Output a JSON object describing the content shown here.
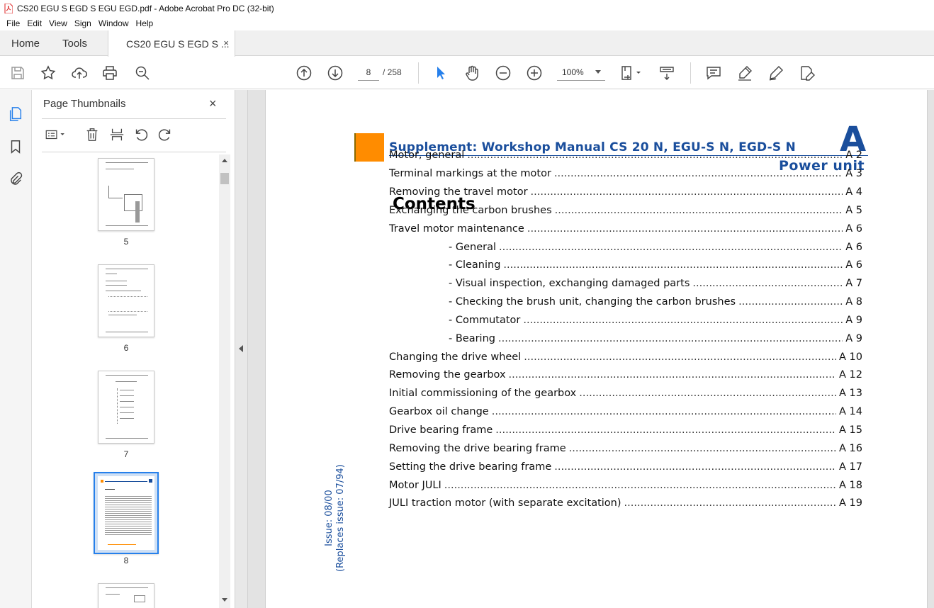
{
  "window": {
    "title": "CS20 EGU S EGD S EGU EGD.pdf - Adobe Acrobat Pro DC (32-bit)"
  },
  "menu": [
    "File",
    "Edit",
    "View",
    "Sign",
    "Window",
    "Help"
  ],
  "tabs": {
    "home": "Home",
    "tools": "Tools",
    "document": "CS20 EGU S EGD S ...",
    "close": "×"
  },
  "toolbar": {
    "page_current": "8",
    "page_total": "/  258",
    "zoom": "100%"
  },
  "panel": {
    "title": "Page Thumbnails",
    "close": "×",
    "thumbnails": [
      "5",
      "6",
      "7",
      "8"
    ]
  },
  "document": {
    "header": "Supplement: Workshop Manual CS 20 N, EGU-S N, EGD-S N",
    "section_letter": "A",
    "section_title": "Power  unit",
    "contents_title": "Contents",
    "issue_line1": "Issue:  08/00",
    "issue_line2": "(Replaces  issue:  07/94)",
    "toc": [
      {
        "title": "Motor, general",
        "page": "A 2",
        "sub": false
      },
      {
        "title": "Terminal markings at the motor",
        "page": "A 3",
        "sub": false
      },
      {
        "title": "Removing the travel motor",
        "page": "A 4",
        "sub": false
      },
      {
        "title": "Exchanging the carbon brushes",
        "page": "A 5",
        "sub": false
      },
      {
        "title": "Travel motor maintenance",
        "page": "A 6",
        "sub": false
      },
      {
        "title": "- General",
        "page": "A 6",
        "sub": true
      },
      {
        "title": "- Cleaning",
        "page": "A 6",
        "sub": true
      },
      {
        "title": "- Visual inspection, exchanging damaged parts",
        "page": "A 7",
        "sub": true
      },
      {
        "title": "- Checking the brush unit, changing the carbon brushes",
        "page": "A 8",
        "sub": true
      },
      {
        "title": "- Commutator",
        "page": "A 9",
        "sub": true
      },
      {
        "title": "- Bearing",
        "page": "A 9",
        "sub": true
      },
      {
        "title": "Changing the drive wheel",
        "page": "A 10",
        "sub": false
      },
      {
        "title": "Removing the gearbox",
        "page": "A 12",
        "sub": false
      },
      {
        "title": "Initial commissioning of the gearbox",
        "page": "A 13",
        "sub": false
      },
      {
        "title": "Gearbox oil change",
        "page": "A 14",
        "sub": false
      },
      {
        "title": "Drive bearing frame",
        "page": "A 15",
        "sub": false
      },
      {
        "title": "Removing the drive bearing frame",
        "page": "A 16",
        "sub": false
      },
      {
        "title": "Setting the drive bearing frame",
        "page": "A 17",
        "sub": false
      },
      {
        "title": "Motor JULI",
        "page": "A 18",
        "sub": false
      },
      {
        "title": "JULI traction motor (with separate excitation)",
        "page": "A 19",
        "sub": false
      }
    ]
  },
  "colors": {
    "accent_blue": "#1a4e9c",
    "orange": "#ff8c00",
    "select_blue": "#2680eb"
  }
}
